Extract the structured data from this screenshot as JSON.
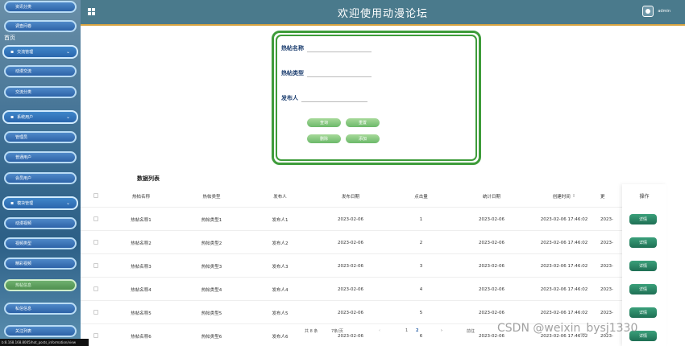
{
  "header": {
    "title": "欢迎使用动漫论坛",
    "user": "admin"
  },
  "sidebar": {
    "hint": "首页",
    "items": [
      {
        "label": "资讯分类",
        "type": "item"
      },
      {
        "label": "调查问卷",
        "type": "item"
      },
      {
        "label": "交流管理",
        "type": "group"
      },
      {
        "label": "动漫交流",
        "type": "item"
      },
      {
        "label": "交流分类",
        "type": "item"
      },
      {
        "label": "系统用户",
        "type": "group"
      },
      {
        "label": "管理员",
        "type": "item"
      },
      {
        "label": "普通用户",
        "type": "item"
      },
      {
        "label": "会员用户",
        "type": "item"
      },
      {
        "label": "模块管理",
        "type": "group"
      },
      {
        "label": "动漫视频",
        "type": "item"
      },
      {
        "label": "视频类型",
        "type": "item"
      },
      {
        "label": "精彩视频",
        "type": "item"
      },
      {
        "label": "热帖信息",
        "type": "item",
        "active": true
      },
      {
        "label": "私信信息",
        "type": "item"
      },
      {
        "label": "关注列表",
        "type": "item"
      }
    ]
  },
  "search": {
    "name_label": "热帖名称",
    "type_label": "热帖类型",
    "publisher_label": "发布人",
    "buttons": {
      "query": "查询",
      "reset": "重置",
      "delete": "删除",
      "add": "添加"
    }
  },
  "table": {
    "title": "数据列表",
    "columns": [
      "热帖名称",
      "热帖类型",
      "发布人",
      "发布日期",
      "点击量",
      "统计日期",
      "创建时间",
      "更"
    ],
    "operation_header": "操作",
    "detail_label": "详情",
    "rows": [
      [
        "热帖名称1",
        "热帖类型1",
        "发布人1",
        "2023-02-06",
        "1",
        "2023-02-06",
        "2023-02-06 17:46:02",
        "2023-"
      ],
      [
        "热帖名称2",
        "热帖类型2",
        "发布人2",
        "2023-02-06",
        "2",
        "2023-02-06",
        "2023-02-06 17:46:02",
        "2023-"
      ],
      [
        "热帖名称3",
        "热帖类型3",
        "发布人3",
        "2023-02-06",
        "3",
        "2023-02-06",
        "2023-02-06 17:46:02",
        "2023-"
      ],
      [
        "热帖名称4",
        "热帖类型4",
        "发布人4",
        "2023-02-06",
        "4",
        "2023-02-06",
        "2023-02-06 17:46:02",
        "2023-"
      ],
      [
        "热帖名称5",
        "热帖类型5",
        "发布人5",
        "2023-02-06",
        "5",
        "2023-02-06",
        "2023-02-06 17:46:02",
        "2023-"
      ],
      [
        "热帖名称6",
        "热帖类型6",
        "发布人6",
        "2023-02-06",
        "6",
        "2023-02-06",
        "2023-02-06 17:46:02",
        "2023-"
      ]
    ]
  },
  "pagination": {
    "total": "共 8 条",
    "page_size": "7条/页",
    "pages": [
      "1",
      "2"
    ],
    "jump_label": "前往"
  },
  "status_url": "b:8.168.168.8005/hot_posts_information/view",
  "watermark": "CSDN @weixin_bysj1330"
}
